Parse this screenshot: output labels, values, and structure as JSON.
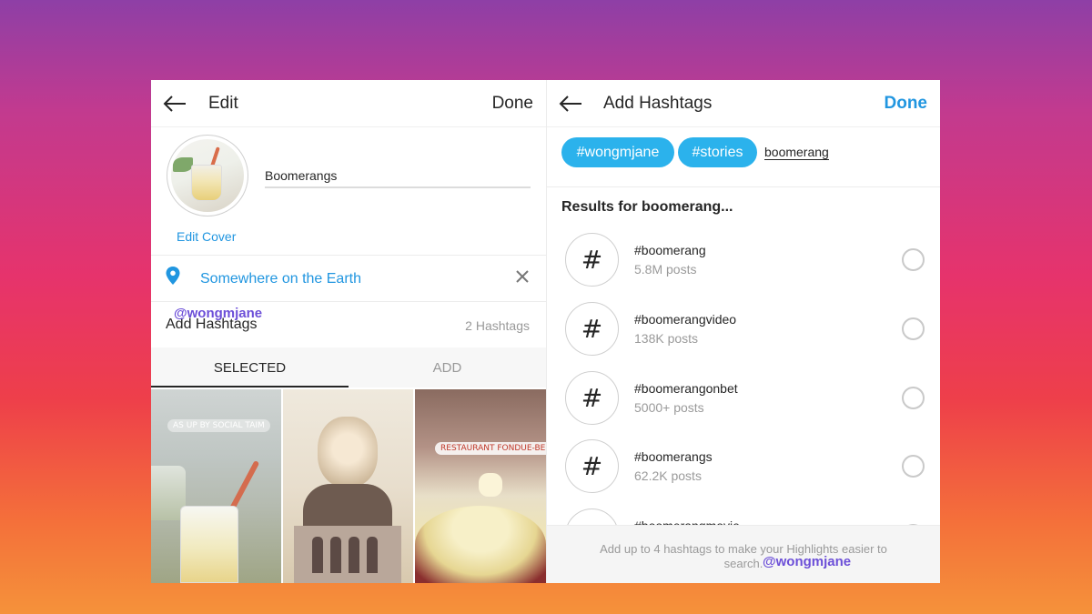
{
  "edit_panel": {
    "title": "Edit",
    "done_label": "Done",
    "highlight_name": "Boomerangs",
    "edit_cover_label": "Edit Cover",
    "location": "Somewhere on the Earth",
    "add_hashtags_label": "Add Hashtags",
    "hashtag_count": "2 Hashtags",
    "tabs": [
      "SELECTED",
      "ADD"
    ],
    "stories": [
      {
        "sticker": "AS UP BY SOCIAL TAIM"
      },
      {
        "sticker": ""
      },
      {
        "sticker": "RESTAURANT FONDUE-BEIZLI"
      }
    ]
  },
  "hashtag_panel": {
    "title": "Add Hashtags",
    "done_label": "Done",
    "selected_chips": [
      "#wongmjane",
      "#stories"
    ],
    "search_query": "boomerang",
    "results_title": "Results for boomerang...",
    "results": [
      {
        "name": "#boomerang",
        "count": "5.8M posts"
      },
      {
        "name": "#boomerangvideo",
        "count": "138K posts"
      },
      {
        "name": "#boomerangonbet",
        "count": "5000+ posts"
      },
      {
        "name": "#boomerangs",
        "count": "62.2K posts"
      },
      {
        "name": "#boomerangmovie",
        "count": ""
      }
    ],
    "hash_symbol": "#",
    "footer_text": "Add up to 4 hashtags to make your Highlights easier to search."
  },
  "watermark": "@wongmjane",
  "colors": {
    "accent_blue": "#2196e0",
    "chip_blue": "#2bb2ec",
    "watermark_purple": "#6c4fd8"
  }
}
